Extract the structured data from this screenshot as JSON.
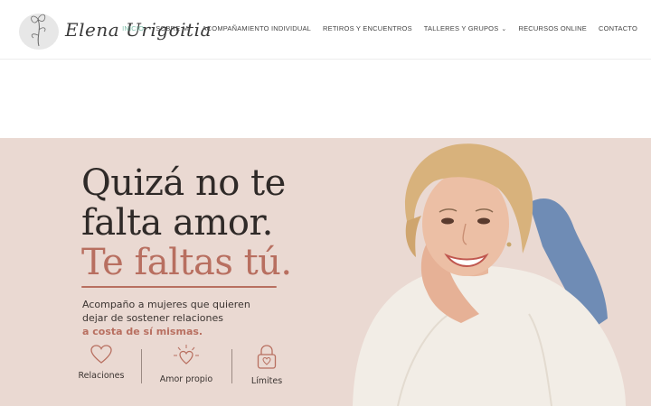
{
  "header": {
    "logo_text": "Elena Urigoitia",
    "nav": [
      {
        "label": "INICIO",
        "active": true,
        "dropdown": false
      },
      {
        "label": "SOBRE MÍ",
        "active": false,
        "dropdown": false
      },
      {
        "label": "ACOMPAÑAMIENTO INDIVIDUAL",
        "active": false,
        "dropdown": false
      },
      {
        "label": "RETIROS Y ENCUENTROS",
        "active": false,
        "dropdown": false
      },
      {
        "label": "TALLERES Y GRUPOS",
        "active": false,
        "dropdown": true
      },
      {
        "label": "RECURSOS ONLINE",
        "active": false,
        "dropdown": false
      },
      {
        "label": "CONTACTO",
        "active": false,
        "dropdown": false
      }
    ]
  },
  "hero": {
    "headline_line1": "Quizá no te",
    "headline_line2": "falta amor.",
    "headline_accent": "Te faltas tú.",
    "sub_line1": "Acompaño a mujeres que quieren",
    "sub_line2": "dejar de sostener relaciones",
    "sub_strong": "a costa de sí mismas.",
    "features": [
      {
        "label": "Relaciones",
        "icon": "heart-icon"
      },
      {
        "label": "Amor propio",
        "icon": "radiant-heart-icon"
      },
      {
        "label": "Límites",
        "icon": "lock-heart-icon"
      }
    ]
  },
  "colors": {
    "accent": "#b86f60",
    "nav_active": "#7bbfa9",
    "hero_bg": "#ead9d2"
  }
}
